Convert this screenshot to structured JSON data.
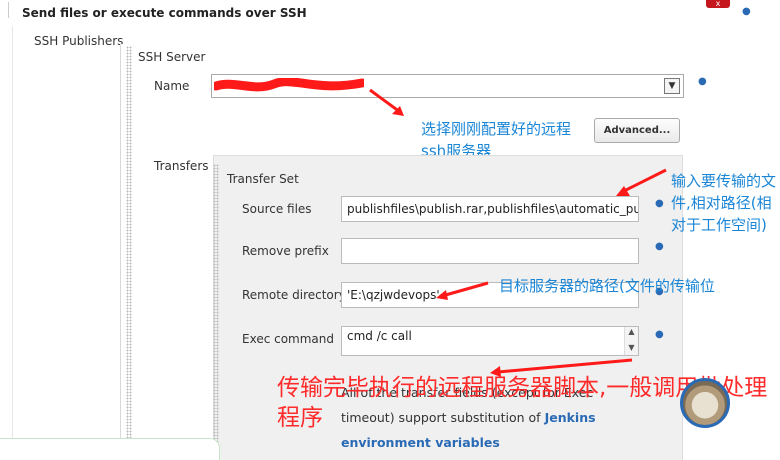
{
  "section": {
    "title": "Send files or execute commands over SSH"
  },
  "ssh_publishers": {
    "label": "SSH Publishers"
  },
  "ssh_server": {
    "heading": "SSH Server",
    "name_label": "Name",
    "name_value": "",
    "advanced_label": "Advanced..."
  },
  "transfers": {
    "label": "Transfers",
    "set_heading": "Transfer Set",
    "source_files_label": "Source files",
    "source_files_value": "publishfiles\\publish.rar,publishfiles\\automatic_puhlish\\c",
    "remove_prefix_label": "Remove prefix",
    "remove_prefix_value": "",
    "remote_directory_label": "Remote directory",
    "remote_directory_value": "'E:\\qzjwdevops'",
    "exec_command_label": "Exec command",
    "exec_command_value": "cmd /c call",
    "note_text": "All of the transfer fields (except for Exec timeout) support substitution of",
    "note_link": "Jenkins environment variables"
  },
  "annotations": {
    "select_server": "选择刚刚配置好的远程ssh服务器",
    "input_files": "输入要传输的文件,相对路径(相对于工作空间)",
    "target_path": "目标服务器的路径(文件的传输位",
    "exec_script": "传输完毕执行的远程服务器脚本,一般调用批处理程序"
  },
  "colors": {
    "annotation_blue": "#1b86d6",
    "annotation_red": "#ff2a2a",
    "link": "#2a6ab5"
  },
  "icons": {
    "help": "help-dot-icon",
    "close": "close-icon",
    "dropdown": "chevron-down-icon"
  }
}
